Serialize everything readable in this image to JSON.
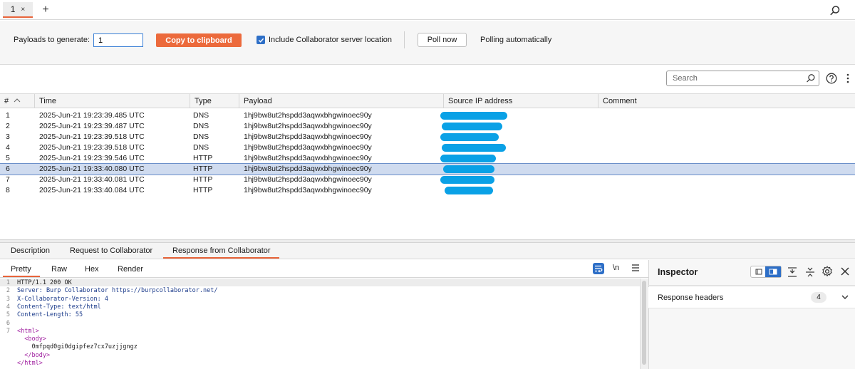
{
  "tabs": {
    "active_label": "1",
    "close_glyph": "×",
    "add_glyph": "+"
  },
  "controls": {
    "payloads_label": "Payloads to generate:",
    "payloads_value": "1",
    "copy_button": "Copy to clipboard",
    "include_checkbox_label": "Include Collaborator server location",
    "include_checked": true,
    "poll_button": "Poll now",
    "polling_status": "Polling automatically"
  },
  "filter": {
    "search_placeholder": "Search"
  },
  "table": {
    "columns": [
      "#",
      "Time",
      "Type",
      "Payload",
      "Source IP address",
      "Comment"
    ],
    "selected_row": 6,
    "rows": [
      {
        "num": "1",
        "time": "2025-Jun-21 19:23:39.485 UTC",
        "type": "DNS",
        "payload": "1hj9bw8ut2hspdd3aqwxbhgwinoec90y"
      },
      {
        "num": "2",
        "time": "2025-Jun-21 19:23:39.487 UTC",
        "type": "DNS",
        "payload": "1hj9bw8ut2hspdd3aqwxbhgwinoec90y"
      },
      {
        "num": "3",
        "time": "2025-Jun-21 19:23:39.518 UTC",
        "type": "DNS",
        "payload": "1hj9bw8ut2hspdd3aqwxbhgwinoec90y"
      },
      {
        "num": "4",
        "time": "2025-Jun-21 19:23:39.518 UTC",
        "type": "DNS",
        "payload": "1hj9bw8ut2hspdd3aqwxbhgwinoec90y"
      },
      {
        "num": "5",
        "time": "2025-Jun-21 19:23:39.546 UTC",
        "type": "HTTP",
        "payload": "1hj9bw8ut2hspdd3aqwxbhgwinoec90y"
      },
      {
        "num": "6",
        "time": "2025-Jun-21 19:33:40.080 UTC",
        "type": "HTTP",
        "payload": "1hj9bw8ut2hspdd3aqwxbhgwinoec90y"
      },
      {
        "num": "7",
        "time": "2025-Jun-21 19:33:40.081 UTC",
        "type": "HTTP",
        "payload": "1hj9bw8ut2hspdd3aqwxbhgwinoec90y"
      },
      {
        "num": "8",
        "time": "2025-Jun-21 19:33:40.084 UTC",
        "type": "HTTP",
        "payload": "1hj9bw8ut2hspdd3aqwxbhgwinoec90y"
      }
    ]
  },
  "detail_tabs": {
    "description": "Description",
    "request": "Request to Collaborator",
    "response": "Response from Collaborator"
  },
  "editor": {
    "tabs": {
      "pretty": "Pretty",
      "raw": "Raw",
      "hex": "Hex",
      "render": "Render"
    },
    "newline_toggle": "\\n",
    "lines": [
      {
        "n": "1",
        "text": "HTTP/1.1 200 OK"
      },
      {
        "n": "2",
        "text": "Server: Burp Collaborator https://burpcollaborator.net/"
      },
      {
        "n": "3",
        "text": "X-Collaborator-Version: 4"
      },
      {
        "n": "4",
        "text": "Content-Type: text/html"
      },
      {
        "n": "5",
        "text": "Content-Length: 55"
      },
      {
        "n": "6",
        "text": ""
      },
      {
        "n": "7",
        "text": "<html>"
      },
      {
        "n": "",
        "text": "  <body>"
      },
      {
        "n": "",
        "text": "    0mfpqd0gi0dgipfez7cx7uzjjgngz"
      },
      {
        "n": "",
        "text": "  </body>"
      },
      {
        "n": "",
        "text": "</html>"
      }
    ]
  },
  "inspector": {
    "title": "Inspector",
    "section_label": "Response headers",
    "section_count": "4"
  },
  "colors": {
    "accent": "#e8643a",
    "selected_row": "#cfdbef",
    "redaction": "#0aa1e6",
    "blue": "#2e6fc7"
  }
}
